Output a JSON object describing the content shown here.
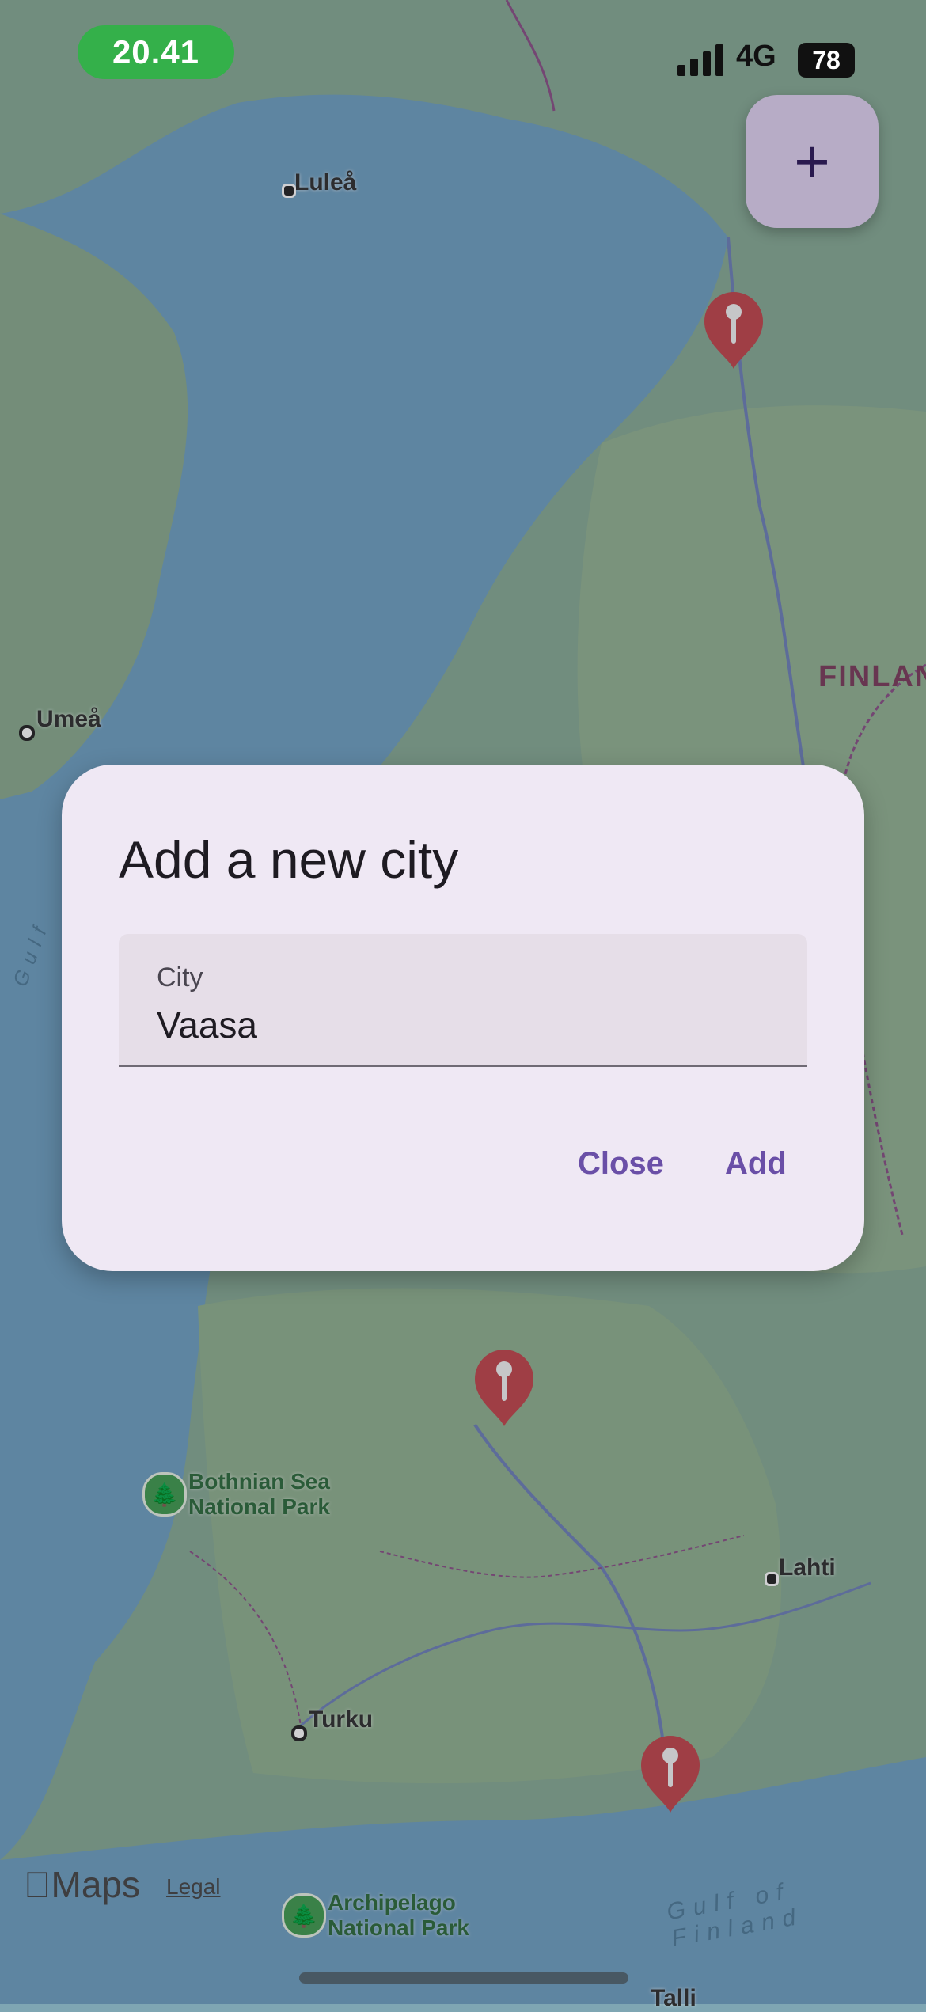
{
  "status_bar": {
    "time": "20.41",
    "network": "4G",
    "battery": "78"
  },
  "fab": {
    "icon": "plus-icon",
    "label": "+"
  },
  "map": {
    "cities": [
      "Luleå",
      "Umeå",
      "Lahti",
      "Turku",
      "Talli"
    ],
    "country_label": "FINLAN",
    "parks": [
      {
        "line1": "Bothnian Sea",
        "line2": "National Park"
      },
      {
        "line1": "Archipelago",
        "line2": "National Park"
      }
    ],
    "water_labels": [
      "Gulf",
      "Gulf of Finland"
    ],
    "attribution": {
      "brand": "Maps",
      "legal": "Legal"
    }
  },
  "dialog": {
    "title": "Add a new city",
    "field_label": "City",
    "field_value": "Vaasa",
    "close_label": "Close",
    "add_label": "Add"
  },
  "colors": {
    "accent": "#6a4fa7",
    "pin": "#c0444b",
    "time_pill": "#34b04a"
  }
}
